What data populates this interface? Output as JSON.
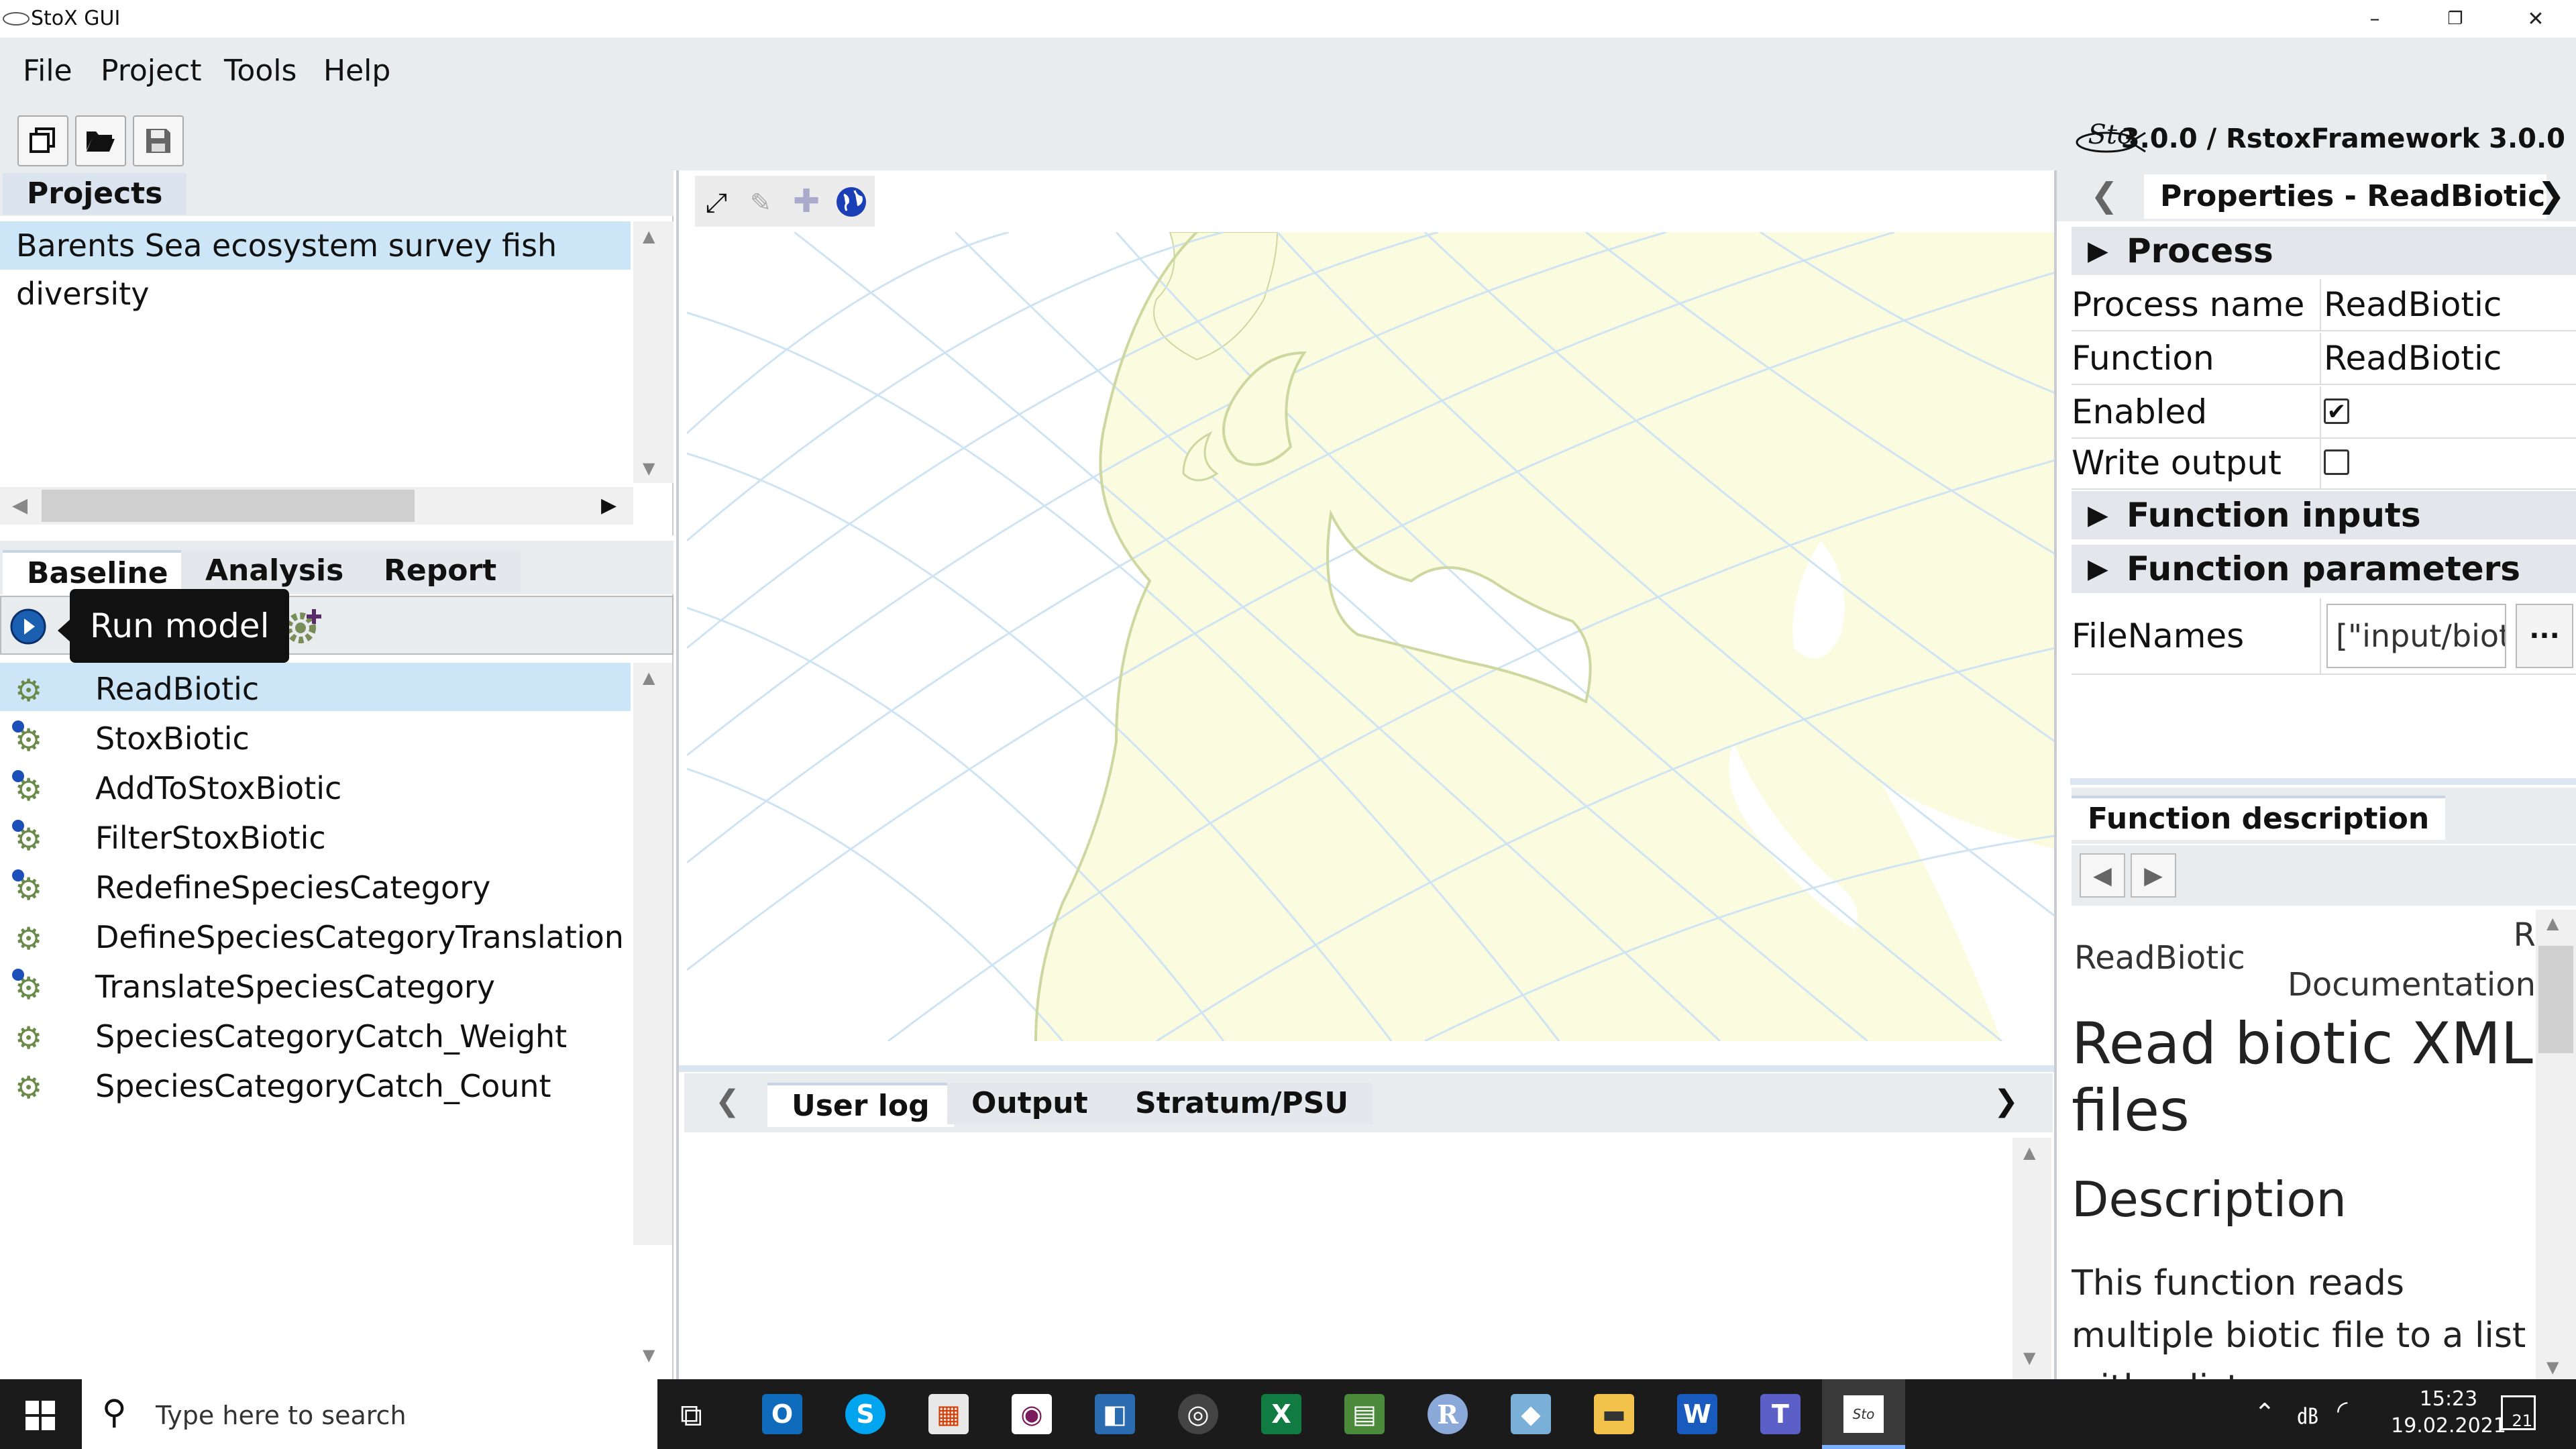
{
  "window": {
    "title": "StoX GUI",
    "minimize": "–",
    "maximize": "❐",
    "close": "✕"
  },
  "menu": [
    "File",
    "Project",
    "Tools",
    "Help"
  ],
  "toolbar": {
    "logo_text": "Sto",
    "version": "3.0.0 / RstoxFramework 3.0.0"
  },
  "projects": {
    "tab": "Projects",
    "items": [
      "Barents Sea ecosystem survey fish diversity"
    ]
  },
  "model_tabs": [
    "Baseline",
    "Analysis",
    "Report"
  ],
  "tooltip": "Run model",
  "processes": [
    "ReadBiotic",
    "StoxBiotic",
    "AddToStoxBiotic",
    "FilterStoxBiotic",
    "RedefineSpeciesCategory",
    "DefineSpeciesCategoryTranslation",
    "TranslateSpeciesCategory",
    "SpeciesCategoryCatch_Weight",
    "SpeciesCategoryCatch_Count"
  ],
  "bottom_tabs": [
    "User log",
    "Output",
    "Stratum/PSU"
  ],
  "properties": {
    "header": "Properties - ReadBiotic",
    "section_process": "Process",
    "process_name_label": "Process name",
    "process_name": "ReadBiotic",
    "function_label": "Function",
    "function": "ReadBiotic",
    "enabled_label": "Enabled",
    "write_output_label": "Write output ...",
    "section_inputs": "Function inputs",
    "section_params": "Function parameters",
    "filenames_label": "FileNames",
    "filenames_value": "[\"input/biot",
    "more_button": "···"
  },
  "description": {
    "tab": "Function description",
    "doc_name": "ReadBiotic",
    "doc_r": "R",
    "doc_label": "Documentation",
    "heading": "Read biotic XML files",
    "subheading": "Description",
    "body": "This function reads multiple biotic file to a list with a list"
  },
  "taskbar": {
    "search_placeholder": "Type here to search",
    "time": "15:23",
    "date": "19.02.2021",
    "notifications": "21"
  }
}
